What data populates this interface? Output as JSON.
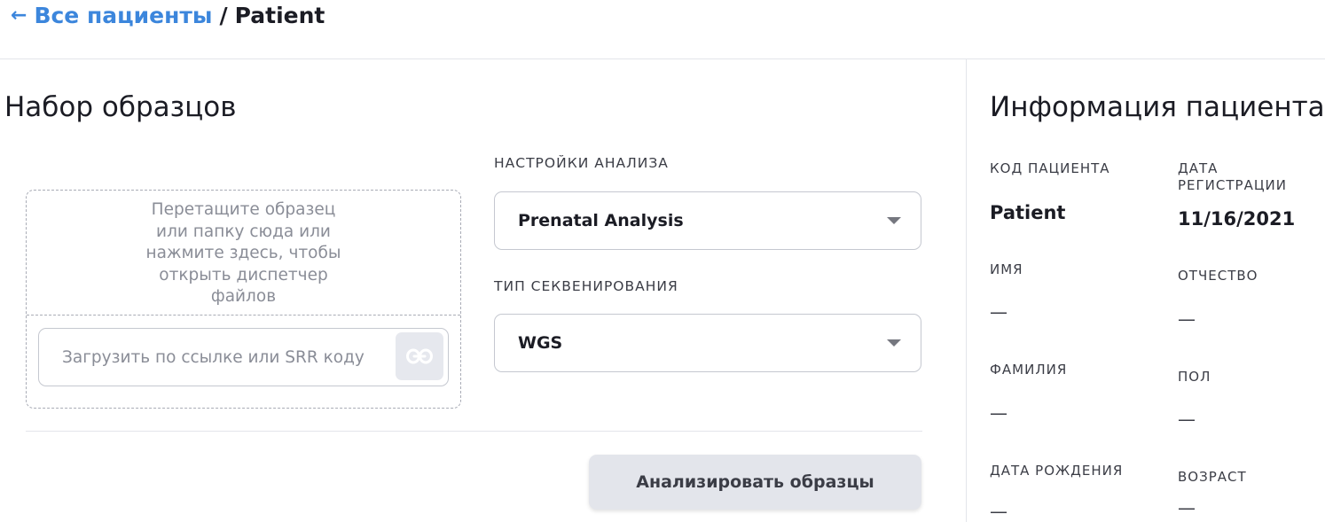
{
  "breadcrumb": {
    "back_arrow": "←",
    "back_label": "Все пациенты",
    "separator": "/",
    "current": "Patient"
  },
  "sample_set": {
    "title": "Набор образцов",
    "dropzone_text": "Перетащите образец или папку сюда или нажмите здесь, чтобы открыть диспетчер файлов",
    "url_placeholder": "Загрузить по ссылке или SRR коду",
    "link_icon": "link-icon"
  },
  "settings": {
    "analysis_label": "НАСТРОЙКИ АНАЛИЗА",
    "analysis_value": "Prenatal Analysis",
    "sequencing_label": "ТИП СЕКВЕНИРОВАНИЯ",
    "sequencing_value": "WGS"
  },
  "actions": {
    "analyze_label": "Анализировать образцы"
  },
  "patient_info": {
    "title": "Информация пациента",
    "patient_code_label": "КОД ПАЦИЕНТА",
    "patient_code_value": "Patient",
    "reg_date_label": "ДАТА РЕГИСТРАЦИИ",
    "reg_date_value": "11/16/2021",
    "first_name_label": "ИМЯ",
    "first_name_value": "—",
    "middle_name_label": "ОТЧЕСТВО",
    "middle_name_value": "—",
    "last_name_label": "ФАМИЛИЯ",
    "last_name_value": "—",
    "sex_label": "ПОЛ",
    "sex_value": "—",
    "birth_date_label": "ДАТА РОЖДЕНИЯ",
    "birth_date_value": "—",
    "age_label": "ВОЗРАСТ",
    "age_value": "—"
  },
  "colors": {
    "link_blue": "#3c86dc",
    "text_dark": "#1b1c24",
    "button_gray": "#e3e5eb"
  }
}
